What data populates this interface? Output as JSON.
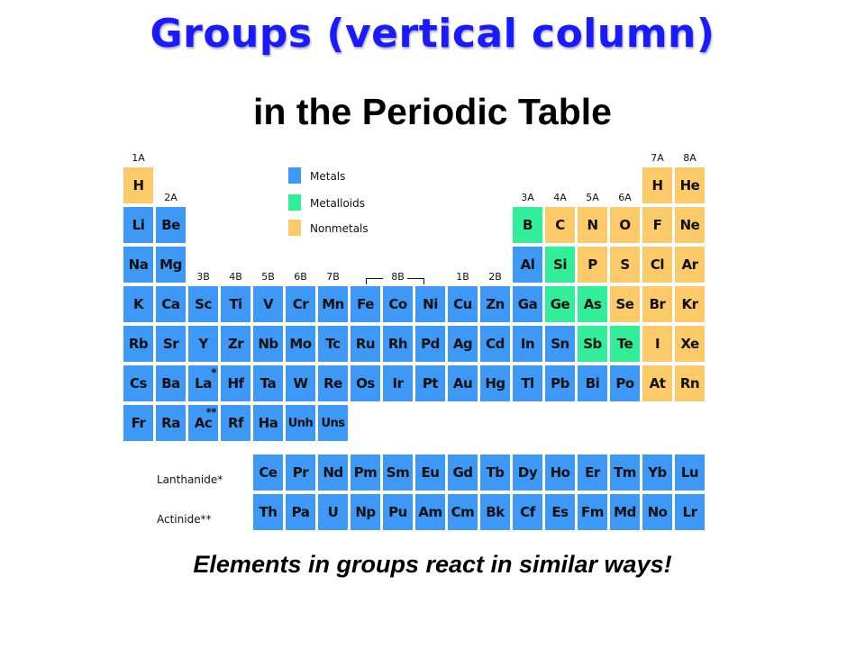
{
  "title": "Groups (vertical column)",
  "subtitle": "in the Periodic Table",
  "tagline": "Elements in groups react in similar ways!",
  "colors": {
    "metal": "#3d99f5",
    "metalloid": "#33ee99",
    "nonmetal": "#fdca6a",
    "title": "#1a1aff"
  },
  "legend": [
    {
      "type": "metal",
      "label": "Metals"
    },
    {
      "type": "metalloid",
      "label": "Metalloids"
    },
    {
      "type": "nonmetal",
      "label": "Nonmetals"
    }
  ],
  "group_labels": [
    {
      "col": 1,
      "period": 1,
      "label": "1A"
    },
    {
      "col": 2,
      "period": 2,
      "label": "2A"
    },
    {
      "col": 3,
      "period": 4,
      "label": "3B"
    },
    {
      "col": 4,
      "period": 4,
      "label": "4B"
    },
    {
      "col": 5,
      "period": 4,
      "label": "5B"
    },
    {
      "col": 6,
      "period": 4,
      "label": "6B"
    },
    {
      "col": 7,
      "period": 4,
      "label": "7B"
    },
    {
      "col": 9,
      "period": 4,
      "label": "8B"
    },
    {
      "col": 11,
      "period": 4,
      "label": "1B"
    },
    {
      "col": 12,
      "period": 4,
      "label": "2B"
    },
    {
      "col": 13,
      "period": 2,
      "label": "3A"
    },
    {
      "col": 14,
      "period": 2,
      "label": "4A"
    },
    {
      "col": 15,
      "period": 2,
      "label": "5A"
    },
    {
      "col": 16,
      "period": 2,
      "label": "6A"
    },
    {
      "col": 17,
      "period": 1,
      "label": "7A"
    },
    {
      "col": 18,
      "period": 1,
      "label": "8A"
    }
  ],
  "elements": [
    {
      "s": "H",
      "col": 1,
      "period": 1,
      "type": "nonmetal"
    },
    {
      "s": "H",
      "col": 17,
      "period": 1,
      "type": "nonmetal"
    },
    {
      "s": "He",
      "col": 18,
      "period": 1,
      "type": "nonmetal"
    },
    {
      "s": "Li",
      "col": 1,
      "period": 2,
      "type": "metal"
    },
    {
      "s": "Be",
      "col": 2,
      "period": 2,
      "type": "metal"
    },
    {
      "s": "B",
      "col": 13,
      "period": 2,
      "type": "metalloid"
    },
    {
      "s": "C",
      "col": 14,
      "period": 2,
      "type": "nonmetal"
    },
    {
      "s": "N",
      "col": 15,
      "period": 2,
      "type": "nonmetal"
    },
    {
      "s": "O",
      "col": 16,
      "period": 2,
      "type": "nonmetal"
    },
    {
      "s": "F",
      "col": 17,
      "period": 2,
      "type": "nonmetal"
    },
    {
      "s": "Ne",
      "col": 18,
      "period": 2,
      "type": "nonmetal"
    },
    {
      "s": "Na",
      "col": 1,
      "period": 3,
      "type": "metal"
    },
    {
      "s": "Mg",
      "col": 2,
      "period": 3,
      "type": "metal"
    },
    {
      "s": "Al",
      "col": 13,
      "period": 3,
      "type": "metal"
    },
    {
      "s": "Si",
      "col": 14,
      "period": 3,
      "type": "metalloid"
    },
    {
      "s": "P",
      "col": 15,
      "period": 3,
      "type": "nonmetal"
    },
    {
      "s": "S",
      "col": 16,
      "period": 3,
      "type": "nonmetal"
    },
    {
      "s": "Cl",
      "col": 17,
      "period": 3,
      "type": "nonmetal"
    },
    {
      "s": "Ar",
      "col": 18,
      "period": 3,
      "type": "nonmetal"
    },
    {
      "s": "K",
      "col": 1,
      "period": 4,
      "type": "metal"
    },
    {
      "s": "Ca",
      "col": 2,
      "period": 4,
      "type": "metal"
    },
    {
      "s": "Sc",
      "col": 3,
      "period": 4,
      "type": "metal"
    },
    {
      "s": "Ti",
      "col": 4,
      "period": 4,
      "type": "metal"
    },
    {
      "s": "V",
      "col": 5,
      "period": 4,
      "type": "metal"
    },
    {
      "s": "Cr",
      "col": 6,
      "period": 4,
      "type": "metal"
    },
    {
      "s": "Mn",
      "col": 7,
      "period": 4,
      "type": "metal"
    },
    {
      "s": "Fe",
      "col": 8,
      "period": 4,
      "type": "metal"
    },
    {
      "s": "Co",
      "col": 9,
      "period": 4,
      "type": "metal"
    },
    {
      "s": "Ni",
      "col": 10,
      "period": 4,
      "type": "metal"
    },
    {
      "s": "Cu",
      "col": 11,
      "period": 4,
      "type": "metal"
    },
    {
      "s": "Zn",
      "col": 12,
      "period": 4,
      "type": "metal"
    },
    {
      "s": "Ga",
      "col": 13,
      "period": 4,
      "type": "metal"
    },
    {
      "s": "Ge",
      "col": 14,
      "period": 4,
      "type": "metalloid"
    },
    {
      "s": "As",
      "col": 15,
      "period": 4,
      "type": "metalloid"
    },
    {
      "s": "Se",
      "col": 16,
      "period": 4,
      "type": "nonmetal"
    },
    {
      "s": "Br",
      "col": 17,
      "period": 4,
      "type": "nonmetal"
    },
    {
      "s": "Kr",
      "col": 18,
      "period": 4,
      "type": "nonmetal"
    },
    {
      "s": "Rb",
      "col": 1,
      "period": 5,
      "type": "metal"
    },
    {
      "s": "Sr",
      "col": 2,
      "period": 5,
      "type": "metal"
    },
    {
      "s": "Y",
      "col": 3,
      "period": 5,
      "type": "metal"
    },
    {
      "s": "Zr",
      "col": 4,
      "period": 5,
      "type": "metal"
    },
    {
      "s": "Nb",
      "col": 5,
      "period": 5,
      "type": "metal"
    },
    {
      "s": "Mo",
      "col": 6,
      "period": 5,
      "type": "metal"
    },
    {
      "s": "Tc",
      "col": 7,
      "period": 5,
      "type": "metal"
    },
    {
      "s": "Ru",
      "col": 8,
      "period": 5,
      "type": "metal"
    },
    {
      "s": "Rh",
      "col": 9,
      "period": 5,
      "type": "metal"
    },
    {
      "s": "Pd",
      "col": 10,
      "period": 5,
      "type": "metal"
    },
    {
      "s": "Ag",
      "col": 11,
      "period": 5,
      "type": "metal"
    },
    {
      "s": "Cd",
      "col": 12,
      "period": 5,
      "type": "metal"
    },
    {
      "s": "In",
      "col": 13,
      "period": 5,
      "type": "metal"
    },
    {
      "s": "Sn",
      "col": 14,
      "period": 5,
      "type": "metal"
    },
    {
      "s": "Sb",
      "col": 15,
      "period": 5,
      "type": "metalloid"
    },
    {
      "s": "Te",
      "col": 16,
      "period": 5,
      "type": "metalloid"
    },
    {
      "s": "I",
      "col": 17,
      "period": 5,
      "type": "nonmetal"
    },
    {
      "s": "Xe",
      "col": 18,
      "period": 5,
      "type": "nonmetal"
    },
    {
      "s": "Cs",
      "col": 1,
      "period": 6,
      "type": "metal"
    },
    {
      "s": "Ba",
      "col": 2,
      "period": 6,
      "type": "metal"
    },
    {
      "s": "La",
      "col": 3,
      "period": 6,
      "type": "metal",
      "mark": "*"
    },
    {
      "s": "Hf",
      "col": 4,
      "period": 6,
      "type": "metal"
    },
    {
      "s": "Ta",
      "col": 5,
      "period": 6,
      "type": "metal"
    },
    {
      "s": "W",
      "col": 6,
      "period": 6,
      "type": "metal"
    },
    {
      "s": "Re",
      "col": 7,
      "period": 6,
      "type": "metal"
    },
    {
      "s": "Os",
      "col": 8,
      "period": 6,
      "type": "metal"
    },
    {
      "s": "Ir",
      "col": 9,
      "period": 6,
      "type": "metal"
    },
    {
      "s": "Pt",
      "col": 10,
      "period": 6,
      "type": "metal"
    },
    {
      "s": "Au",
      "col": 11,
      "period": 6,
      "type": "metal"
    },
    {
      "s": "Hg",
      "col": 12,
      "period": 6,
      "type": "metal"
    },
    {
      "s": "Tl",
      "col": 13,
      "period": 6,
      "type": "metal"
    },
    {
      "s": "Pb",
      "col": 14,
      "period": 6,
      "type": "metal"
    },
    {
      "s": "Bi",
      "col": 15,
      "period": 6,
      "type": "metal"
    },
    {
      "s": "Po",
      "col": 16,
      "period": 6,
      "type": "metal"
    },
    {
      "s": "At",
      "col": 17,
      "period": 6,
      "type": "nonmetal"
    },
    {
      "s": "Rn",
      "col": 18,
      "period": 6,
      "type": "nonmetal"
    },
    {
      "s": "Fr",
      "col": 1,
      "period": 7,
      "type": "metal"
    },
    {
      "s": "Ra",
      "col": 2,
      "period": 7,
      "type": "metal"
    },
    {
      "s": "Ac",
      "col": 3,
      "period": 7,
      "type": "metal",
      "mark": "**"
    },
    {
      "s": "Rf",
      "col": 4,
      "period": 7,
      "type": "metal"
    },
    {
      "s": "Ha",
      "col": 5,
      "period": 7,
      "type": "metal"
    },
    {
      "s": "Unh",
      "col": 6,
      "period": 7,
      "type": "metal"
    },
    {
      "s": "Uns",
      "col": 7,
      "period": 7,
      "type": "metal"
    }
  ],
  "lanthanides": {
    "label": "Lanthanide*",
    "elements": [
      "Ce",
      "Pr",
      "Nd",
      "Pm",
      "Sm",
      "Eu",
      "Gd",
      "Tb",
      "Dy",
      "Ho",
      "Er",
      "Tm",
      "Yb",
      "Lu"
    ],
    "type": "metal"
  },
  "actinides": {
    "label": "Actinide**",
    "elements": [
      "Th",
      "Pa",
      "U",
      "Np",
      "Pu",
      "Am",
      "Cm",
      "Bk",
      "Cf",
      "Es",
      "Fm",
      "Md",
      "No",
      "Lr"
    ],
    "type": "metal"
  }
}
